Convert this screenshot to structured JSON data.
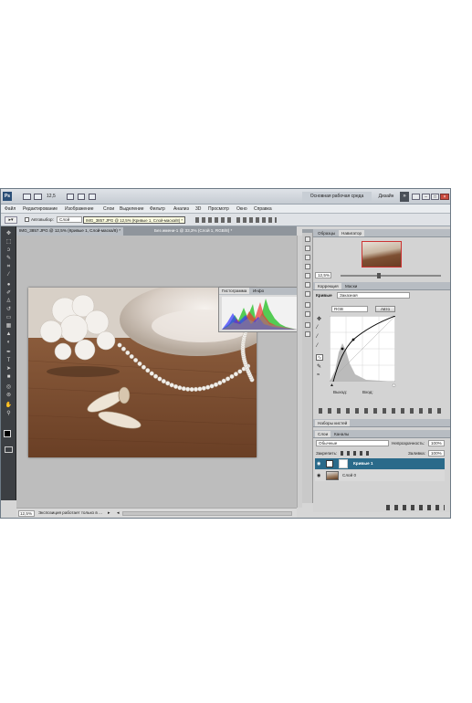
{
  "titlebar": {
    "logo": "Ps",
    "zoom": "12,5",
    "workspace_label": "Основная рабочая среда",
    "design_label": "Дизайн"
  },
  "menu": [
    "Файл",
    "Редактирование",
    "Изображение",
    "Слои",
    "Выделение",
    "Фильтр",
    "Анализ",
    "3D",
    "Просмотр",
    "Окно",
    "Справка"
  ],
  "options": {
    "autoselect_label": "Автовыбор:",
    "autoselect_value": "Слой",
    "tooltip": "IMG_3857.JPG @ 12,5% (Кривые 1, Слой-маска/8) *"
  },
  "doc_tabs": [
    {
      "label": "IMG_3857.JPG @ 12,5% (Кривые 1, Слой-маска/8) *",
      "active": true
    },
    {
      "label": "Без имени-1 @ 33,3% (Слой 1, RGB/8) *",
      "active": false
    }
  ],
  "histogram": {
    "tabs": [
      "Гистограмма",
      "Инфо"
    ]
  },
  "status": {
    "zoom": "12,5%",
    "text": "Экспозиция работает только в ..."
  },
  "navigator": {
    "tabs": [
      "Образцы",
      "Навигатор"
    ],
    "zoom": "12,5%"
  },
  "adjustments": {
    "tabs": [
      "Коррекция",
      "Маски"
    ],
    "curves_label": "Кривые",
    "preset_value": "Заказная",
    "channel_value": "RGB",
    "auto_button": "Авто",
    "output_label": "Выход:",
    "input_label": "Вход:"
  },
  "history": {
    "label": "Наборы кистей"
  },
  "layers": {
    "tabs": [
      "Слои",
      "Каналы"
    ],
    "blend_mode": "Обычные",
    "opacity_label": "Непрозрачность:",
    "opacity_value": "100%",
    "lock_label": "Закрепить:",
    "fill_label": "Заливка:",
    "fill_value": "100%",
    "items": [
      {
        "name": "Кривые 1",
        "selected": true
      },
      {
        "name": "Слой 0",
        "selected": false
      }
    ]
  },
  "colors": {
    "accent": "#2a6a8a",
    "workspace": "#bdbdbd",
    "toolbox": "#3c3f43"
  }
}
